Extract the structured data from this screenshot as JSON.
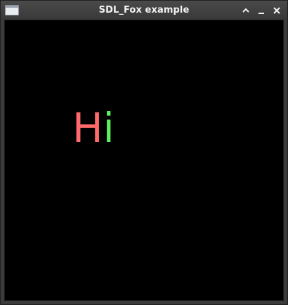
{
  "window": {
    "title": "SDL_Fox example",
    "icons": {
      "app": "window-app-icon",
      "maximize": "chevron-up-icon",
      "minimize": "minimize-icon",
      "close": "close-icon"
    }
  },
  "canvas": {
    "background": "#000000",
    "greeting": {
      "h": "H",
      "i": "i",
      "h_color": "#ff6b6b",
      "i_color": "#5cf05c"
    }
  }
}
